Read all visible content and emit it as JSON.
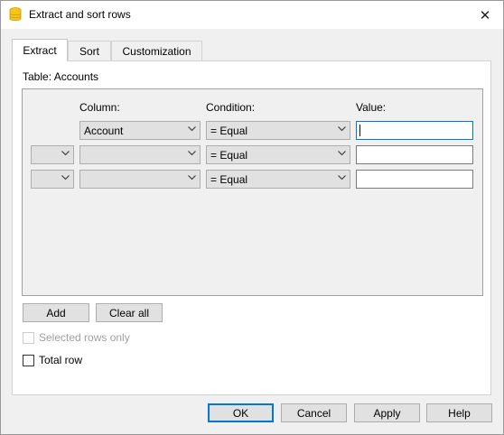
{
  "window": {
    "title": "Extract and sort rows",
    "close_glyph": "✕"
  },
  "tabs": [
    {
      "label": "Extract",
      "active": true
    },
    {
      "label": "Sort",
      "active": false
    },
    {
      "label": "Customization",
      "active": false
    }
  ],
  "extract": {
    "table_label": "Table: Accounts",
    "headers": {
      "column": "Column:",
      "condition": "Condition:",
      "value": "Value:"
    },
    "rows": [
      {
        "operator": "",
        "column": "Account",
        "condition": "= Equal",
        "value": ""
      },
      {
        "operator": "",
        "column": "",
        "condition": "= Equal",
        "value": ""
      },
      {
        "operator": "",
        "column": "",
        "condition": "= Equal",
        "value": ""
      }
    ],
    "add_label": "Add",
    "clear_all_label": "Clear all",
    "selected_rows_only_label": "Selected rows only",
    "total_row_label": "Total row"
  },
  "buttons": {
    "ok": "OK",
    "cancel": "Cancel",
    "apply": "Apply",
    "help": "Help"
  },
  "colors": {
    "accent": "#0078d7",
    "icon_yellow": "#f5c518"
  },
  "icons": {
    "app": "database-icon",
    "chevron": "chevron-down-icon"
  }
}
